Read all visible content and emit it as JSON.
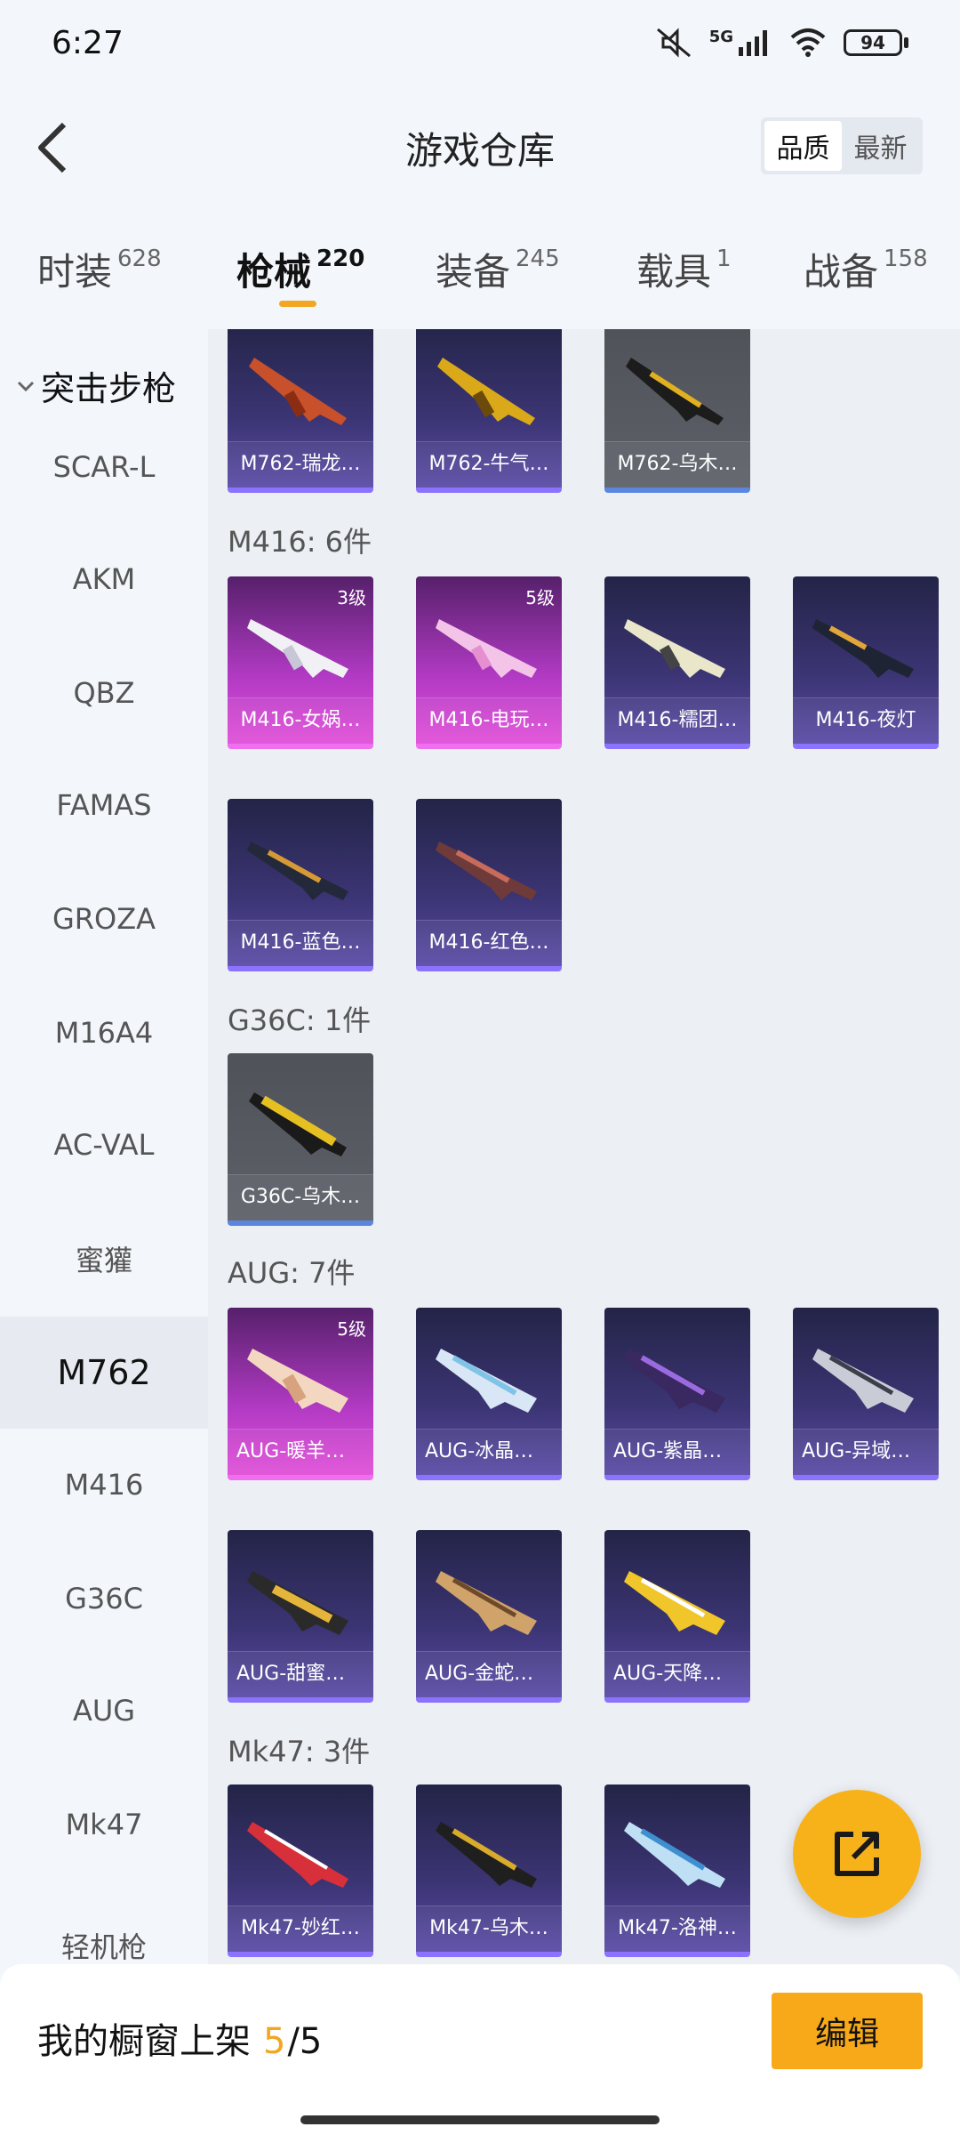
{
  "status": {
    "time": "6:27",
    "battery": "94",
    "network": "5G"
  },
  "header": {
    "title": "游戏仓库",
    "sort_options": [
      "品质",
      "最新"
    ]
  },
  "tabs": [
    {
      "label": "时装",
      "count": "628"
    },
    {
      "label": "枪械",
      "count": "220"
    },
    {
      "label": "装备",
      "count": "245"
    },
    {
      "label": "载具",
      "count": "1"
    },
    {
      "label": "战备",
      "count": "158"
    }
  ],
  "sidebar": {
    "heading": "突击步枪",
    "items": [
      "SCAR-L",
      "AKM",
      "QBZ",
      "FAMAS",
      "GROZA",
      "M16A4",
      "AC-VAL",
      "蜜獾",
      "M762",
      "M416",
      "G36C",
      "AUG",
      "Mk47"
    ],
    "partial": "轻机枪"
  },
  "groups": {
    "m762": {
      "cards": [
        "M762-瑞龙…",
        "M762-牛气…",
        "M762-乌木…"
      ]
    },
    "m416": {
      "title": "M416: 6件",
      "cards": [
        "M416-女娲…",
        "M416-电玩…",
        "M416-糯团…",
        "M416-夜灯",
        "M416-蓝色…",
        "M416-红色…"
      ],
      "levels": [
        "3级",
        "5级"
      ]
    },
    "g36c": {
      "title": "G36C: 1件",
      "cards": [
        "G36C-乌木…"
      ]
    },
    "aug": {
      "title": "AUG: 7件",
      "cards": [
        "AUG-暖羊咩咩",
        "AUG-冰晶雪宝",
        "AUG-紫晶流影",
        "AUG-异域银装",
        "AUG-甜蜜菠萝",
        "AUG-金蛇镇世",
        "AUG-天降萌叽"
      ],
      "levels": [
        "5级"
      ]
    },
    "mk47": {
      "title": "Mk47: 3件",
      "cards": [
        "Mk47-妙红…",
        "Mk47-乌木…",
        "Mk47-洛神…"
      ]
    }
  },
  "bottom": {
    "showcase_label": "我的橱窗上架",
    "current": "5",
    "total": "/5",
    "edit_label": "编辑"
  },
  "colors": {
    "accent": "#f2a622",
    "epic": "#8b73ff",
    "legendary": "#e04fd8"
  }
}
